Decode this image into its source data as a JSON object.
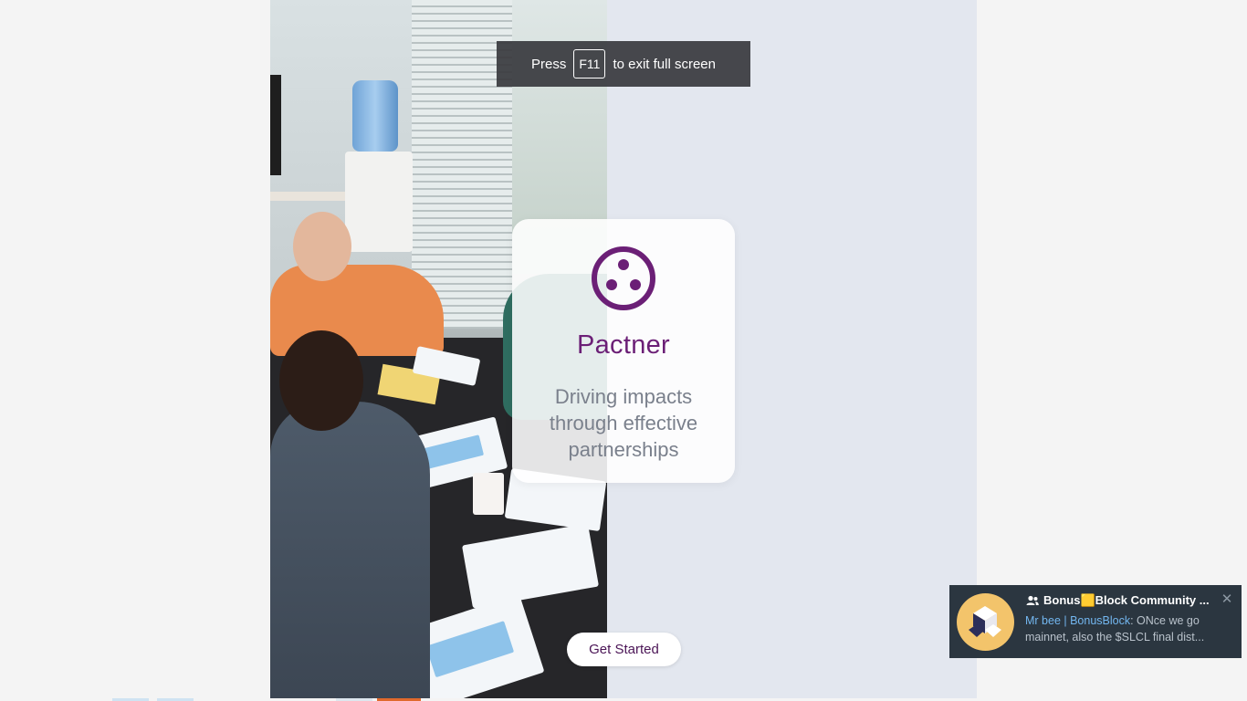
{
  "fullscreen_toast": {
    "prefix": "Press",
    "key": "F11",
    "suffix": "to exit full screen"
  },
  "brand": {
    "logo_icon": "three-dots-circle-icon",
    "name": "Pactner",
    "tagline": "Driving impacts through effective partnerships",
    "color": "#6b1f76"
  },
  "cta": {
    "label": "Get Started"
  },
  "notification": {
    "group_icon": "group-icon",
    "title": "Bonus🟨Block Community ...",
    "sender": "Mr bee | BonusBlock",
    "message": ": ONce we go mainnet, also the $SLCL final dist...",
    "close_icon": "close-icon",
    "close_symbol": "✕"
  },
  "colors": {
    "page_bg": "#f4f4f4",
    "frame_bg": "#e3e7ef",
    "notif_bg": "#2b3640",
    "link": "#73b7f0"
  }
}
